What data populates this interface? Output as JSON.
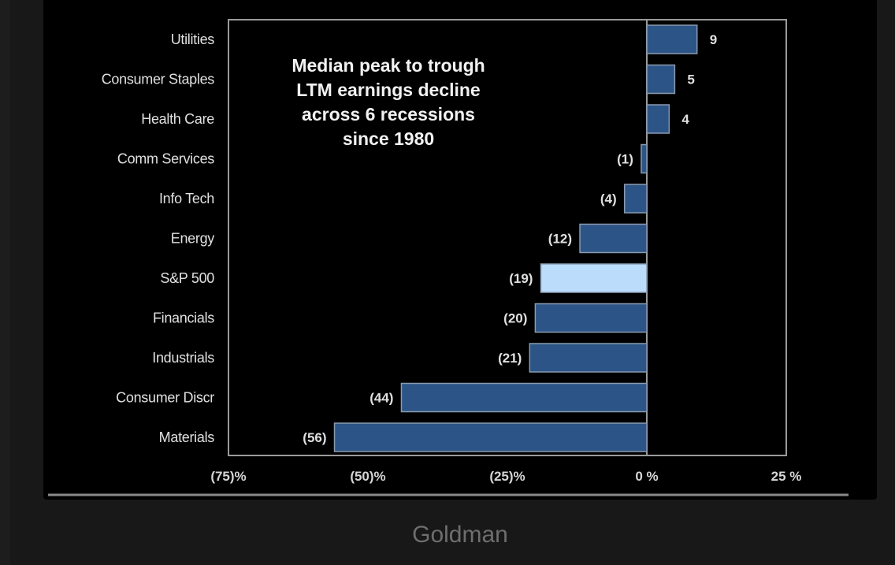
{
  "chart_data": {
    "type": "bar",
    "orientation": "horizontal",
    "title": [
      "Median peak to trough",
      "LTM earnings decline",
      "across 6 recessions",
      "since 1980"
    ],
    "categories": [
      "Utilities",
      "Consumer Staples",
      "Health Care",
      "Comm Services",
      "Info Tech",
      "Energy",
      "S&P 500",
      "Financials",
      "Industrials",
      "Consumer Discr",
      "Materials"
    ],
    "values": [
      9,
      5,
      4,
      -1,
      -4,
      -12,
      -19,
      -20,
      -21,
      -44,
      -56
    ],
    "value_labels": [
      "9",
      "5",
      "4",
      "(1)",
      "(4)",
      "(12)",
      "(19)",
      "(20)",
      "(21)",
      "(44)",
      "(56)"
    ],
    "highlight_category": "S&P 500",
    "xlabel": "",
    "ylabel": "",
    "xlim": [
      -75,
      25
    ],
    "x_ticks": [
      -75,
      -50,
      -25,
      0,
      25
    ],
    "x_tick_labels": [
      "(75)%",
      "(50)%",
      "(25)%",
      "0 %",
      "25 %"
    ],
    "grid": false,
    "legend": "none",
    "colors": {
      "bar": "#2c5486",
      "bar_highlight": "#bcdcfb",
      "bar_border": "#8a9bb0",
      "frame": "#9a9a9a",
      "background": "#000000"
    }
  },
  "caption": "Goldman"
}
